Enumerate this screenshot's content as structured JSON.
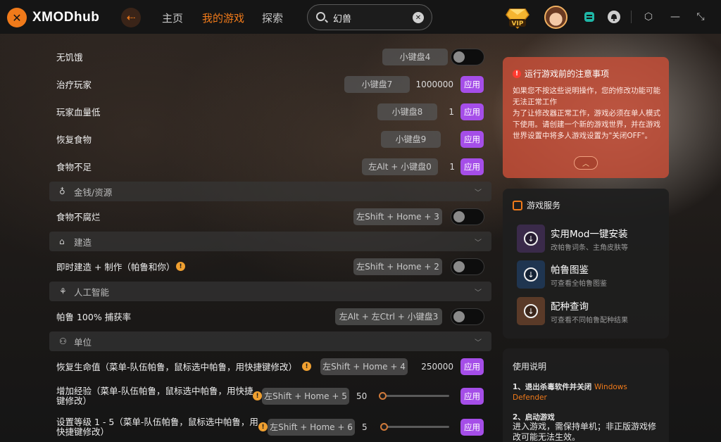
{
  "brand": {
    "name": "XMOD",
    "suffix": "hub",
    "accent": "#f07a1a"
  },
  "nav": {
    "home": "主页",
    "my_games": "我的游戏",
    "explore": "探索"
  },
  "search": {
    "value": "幻兽",
    "placeholder": ""
  },
  "header_icons": [
    "back-arrow-icon",
    "vip-badge-icon",
    "avatar",
    "discord-icon",
    "notification-icon",
    "settings-icon",
    "minimize-icon",
    "close-icon"
  ],
  "vip_label": "VIP",
  "rows": [
    {
      "label": "无饥饿",
      "key": "小键盘4",
      "type": "toggle",
      "on": false
    },
    {
      "label": "治疗玩家",
      "key": "小键盘7",
      "value": "1000000",
      "action": "应用"
    },
    {
      "label": "玩家血量低",
      "key": "小键盘8",
      "value": "1",
      "action": "应用"
    },
    {
      "label": "恢复食物",
      "key": "小键盘9",
      "action": "应用"
    },
    {
      "label": "食物不足",
      "key": "左Alt + 小键盘0",
      "value": "1",
      "action": "应用"
    }
  ],
  "sections": [
    {
      "label": "金钱/资源",
      "icon": "money-bag-icon"
    },
    {
      "label": "建造",
      "icon": "building-icon"
    },
    {
      "label": "人工智能",
      "icon": "ai-icon"
    },
    {
      "label": "单位",
      "icon": "unit-icon"
    }
  ],
  "row_money": {
    "label": "食物不腐烂",
    "key": "左Shift + Home + 3",
    "on": false
  },
  "row_build": {
    "label": "即时建造 + 制作（帕鲁和你）",
    "key": "左Shift + Home + 2",
    "on": false
  },
  "row_ai": {
    "label": "帕鲁 100% 捕获率",
    "key": "左Alt + 左Ctrl + 小键盘3",
    "on": false
  },
  "unit_rows": [
    {
      "label": "恢复生命值（菜单-队伍帕鲁，鼠标选中帕鲁，用快捷键修改）",
      "key": "左Shift + Home + 4",
      "value": "250000",
      "action": "应用"
    },
    {
      "label": "增加经验（菜单-队伍帕鲁，鼠标选中帕鲁，用快捷键修改）",
      "key": "左Shift + Home + 5",
      "value": "50",
      "action": "应用",
      "slider": 0.0
    },
    {
      "label": "设置等级 1 - 5（菜单-队伍帕鲁，鼠标选中帕鲁，用快捷键修改）",
      "key": "左Shift + Home + 6",
      "value": "5",
      "action": "应用",
      "slider": 0.0
    }
  ],
  "notice": {
    "title": "运行游戏前的注意事项",
    "body": "如果您不按这些说明操作，您的修改功能可能无法正常工作\n为了让修改器正常工作，游戏必须在单人模式下使用。请创建一个新的游戏世界，并在游戏世界设置中将多人游戏设置为\"关闭OFF\"。",
    "collapse_icon": "chevron-up-icon"
  },
  "services": {
    "title": "游戏服务",
    "items": [
      {
        "name": "实用Mod一键安装",
        "desc": "改帕鲁词条、主角皮肤等",
        "color": "#3a2a4a"
      },
      {
        "name": "帕鲁图鉴",
        "desc": "可查看全帕鲁图鉴",
        "color": "#1f3550"
      },
      {
        "name": "配种查询",
        "desc": "可查看不同帕鲁配种结果",
        "color": "#5a3a28"
      }
    ]
  },
  "guide": {
    "title": "使用说明",
    "step1_prefix": "1、退出杀毒软件并关闭",
    "step1_highlight": "Windows Defender",
    "step2_title": "2、启动游戏",
    "step2_desc": "进入游戏，需保持单机；非正版游戏修改可能无法生效。"
  }
}
